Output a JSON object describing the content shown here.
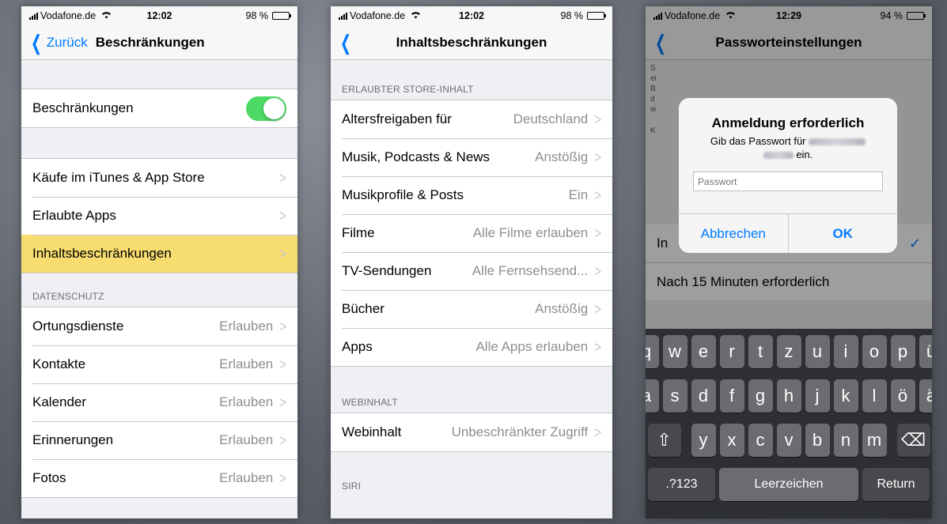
{
  "phone1": {
    "status": {
      "carrier": "Vodafone.de",
      "time": "12:02",
      "battery": "98 %",
      "battery_level": 0.98
    },
    "nav": {
      "back_label": "Zurück",
      "title": "Beschränkungen"
    },
    "toggle_row": {
      "label": "Beschränkungen",
      "state": "on"
    },
    "items": [
      {
        "label": "Käufe im iTunes & App Store"
      },
      {
        "label": "Erlaubte Apps"
      },
      {
        "label": "Inhaltsbeschränkungen",
        "highlighted": true
      }
    ],
    "privacy_header": "DATENSCHUTZ",
    "privacy_items": [
      {
        "label": "Ortungsdienste",
        "value": "Erlauben"
      },
      {
        "label": "Kontakte",
        "value": "Erlauben"
      },
      {
        "label": "Kalender",
        "value": "Erlauben"
      },
      {
        "label": "Erinnerungen",
        "value": "Erlauben"
      },
      {
        "label": "Fotos",
        "value": "Erlauben"
      }
    ],
    "colors": {
      "toggle_on": "#4cd964",
      "highlight": "#f7dc6f",
      "tint": "#007aff"
    }
  },
  "phone2": {
    "status": {
      "carrier": "Vodafone.de",
      "time": "12:02",
      "battery": "98 %",
      "battery_level": 0.98
    },
    "nav": {
      "title": "Inhaltsbeschränkungen"
    },
    "store_header": "ERLAUBTER STORE-INHALT",
    "store_items": [
      {
        "label": "Altersfreigaben für",
        "value": "Deutschland"
      },
      {
        "label": "Musik, Podcasts & News",
        "value": "Anstößig"
      },
      {
        "label": "Musikprofile & Posts",
        "value": "Ein"
      },
      {
        "label": "Filme",
        "value": "Alle Filme erlauben"
      },
      {
        "label": "TV-Sendungen",
        "value": "Alle Fernsehsend..."
      },
      {
        "label": "Bücher",
        "value": "Anstößig"
      },
      {
        "label": "Apps",
        "value": "Alle Apps erlauben"
      }
    ],
    "web_header": "WEBINHALT",
    "web_items": [
      {
        "label": "Webinhalt",
        "value": "Unbeschränkter Zugriff"
      }
    ],
    "siri_header": "SIRI"
  },
  "phone3": {
    "status": {
      "carrier": "Vodafone.de",
      "time": "12:29",
      "battery": "94 %",
      "battery_level": 0.94
    },
    "nav": {
      "title": "Passworteinstellungen"
    },
    "under_text": [
      "S",
      "ei",
      "B",
      "d",
      "w",
      "K"
    ],
    "row_behind_label": "In",
    "row_label": "Nach 15 Minuten erforderlich",
    "alert": {
      "title": "Anmeldung erforderlich",
      "message_prefix": "Gib das Passwort für",
      "message_suffix": "ein.",
      "password_placeholder": "Passwort",
      "cancel_label": "Abbrechen",
      "ok_label": "OK"
    },
    "keyboard": {
      "row1": [
        "q",
        "w",
        "e",
        "r",
        "t",
        "z",
        "u",
        "i",
        "o",
        "p",
        "ü"
      ],
      "row2": [
        "a",
        "s",
        "d",
        "f",
        "g",
        "h",
        "j",
        "k",
        "l",
        "ö",
        "ä"
      ],
      "row3": [
        "y",
        "x",
        "c",
        "v",
        "b",
        "n",
        "m"
      ],
      "shift": "⇧",
      "backspace": "⌫",
      "mode_label": ".?123",
      "space_label": "Leerzeichen",
      "return_label": "Return"
    }
  }
}
